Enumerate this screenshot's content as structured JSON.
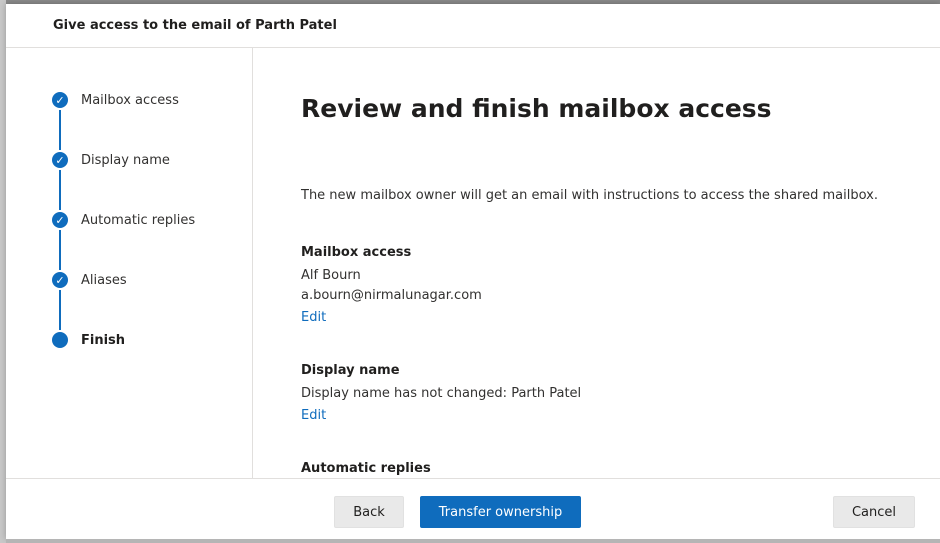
{
  "panel": {
    "title": "Give access to the email of Parth Patel"
  },
  "steps": [
    {
      "label": "Mailbox access",
      "status": "completed"
    },
    {
      "label": "Display name",
      "status": "completed"
    },
    {
      "label": "Automatic replies",
      "status": "completed"
    },
    {
      "label": "Aliases",
      "status": "completed"
    },
    {
      "label": "Finish",
      "status": "current"
    }
  ],
  "content": {
    "title": "Review and finish mailbox access",
    "intro": "The new mailbox owner will get an email with instructions to access the shared mailbox.",
    "sections": {
      "mailbox_access": {
        "heading": "Mailbox access",
        "name": "Alf Bourn",
        "email": "a.bourn@nirmalunagar.com",
        "edit_label": "Edit"
      },
      "display_name": {
        "heading": "Display name",
        "text": "Display name has not changed: Parth Patel",
        "edit_label": "Edit"
      },
      "automatic_replies": {
        "heading": "Automatic replies"
      }
    }
  },
  "footer": {
    "back_label": "Back",
    "transfer_label": "Transfer ownership",
    "cancel_label": "Cancel"
  },
  "colors": {
    "accent": "#0f6cbd",
    "divider": "#e1dfdd"
  },
  "icons": {
    "step_completed": "checkmark-icon",
    "step_current": "filled-circle-icon"
  }
}
